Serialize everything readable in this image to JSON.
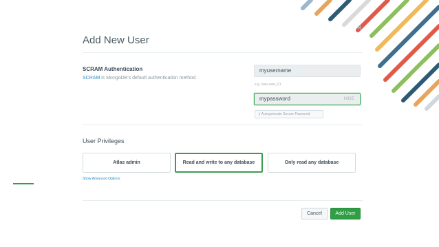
{
  "dialog": {
    "title": "Add New User",
    "close_glyph": "×"
  },
  "scram": {
    "title": "SCRAM Authentication",
    "link_text": "SCRAM",
    "description": " is MongoDB's default authentication method."
  },
  "fields": {
    "username_value": "myusername",
    "username_hint": "e.g. new-user_01",
    "password_value": "mypassword",
    "hide_label": "HIDE",
    "autogen_label": "Autogenerate Secure Password",
    "autogen_icon": "key-icon"
  },
  "privileges": {
    "title": "User Privileges",
    "roles": [
      "Atlas admin",
      "Read and write to any database",
      "Only read any database"
    ],
    "selected": "Read and write to any database",
    "advanced_link": "Show Advanced Options"
  },
  "footer": {
    "cancel_label": "Cancel",
    "add_label": "Add User"
  },
  "colors": {
    "accent_green": "#2f9e44",
    "link_blue": "#2b8dc5"
  }
}
